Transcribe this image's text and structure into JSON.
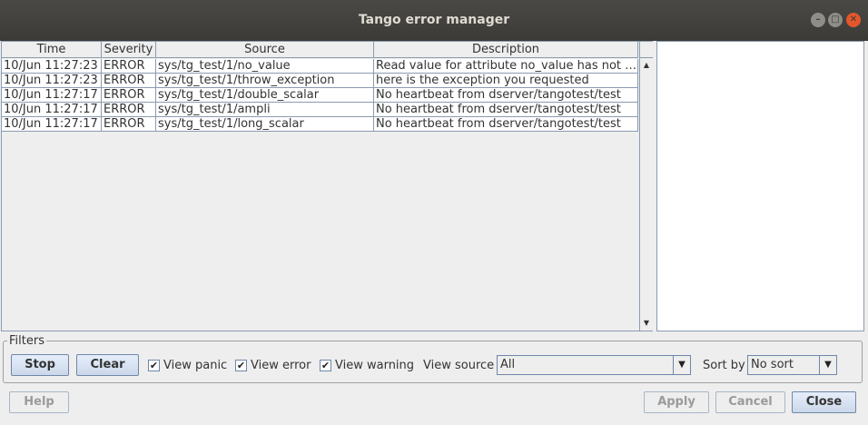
{
  "window": {
    "title": "Tango error manager"
  },
  "table": {
    "columns": [
      "Time",
      "Severity",
      "Source",
      "Description"
    ],
    "rows": [
      {
        "time": "10/Jun 11:27:23",
        "severity": "ERROR",
        "source": "sys/tg_test/1/no_value",
        "description": "Read value for attribute no_value has not b..."
      },
      {
        "time": "10/Jun 11:27:23",
        "severity": "ERROR",
        "source": "sys/tg_test/1/throw_exception",
        "description": "here is the exception you requested"
      },
      {
        "time": "10/Jun 11:27:17",
        "severity": "ERROR",
        "source": "sys/tg_test/1/double_scalar",
        "description": "No heartbeat from dserver/tangotest/test"
      },
      {
        "time": "10/Jun 11:27:17",
        "severity": "ERROR",
        "source": "sys/tg_test/1/ampli",
        "description": "No heartbeat from dserver/tangotest/test"
      },
      {
        "time": "10/Jun 11:27:17",
        "severity": "ERROR",
        "source": "sys/tg_test/1/long_scalar",
        "description": "No heartbeat from dserver/tangotest/test"
      }
    ]
  },
  "filters": {
    "legend": "Filters",
    "stop_label": "Stop",
    "clear_label": "Clear",
    "view_panic": {
      "label": "View panic",
      "checked": true
    },
    "view_error": {
      "label": "View error",
      "checked": true
    },
    "view_warning": {
      "label": "View warning",
      "checked": true
    },
    "view_source_label": "View source",
    "view_source_value": "All",
    "sort_by_label": "Sort by",
    "sort_by_value": "No sort"
  },
  "footer": {
    "help_label": "Help",
    "apply_label": "Apply",
    "cancel_label": "Cancel",
    "close_label": "Close"
  }
}
